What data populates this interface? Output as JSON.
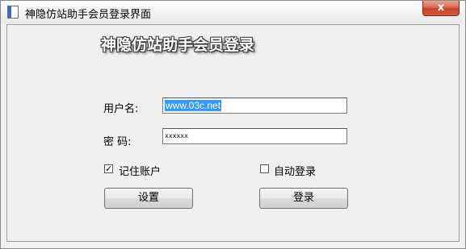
{
  "window": {
    "title": "神隐仿站助手会员登录界面",
    "close_glyph": "x",
    "icons": {
      "app": "app-icon",
      "close": "close-icon"
    }
  },
  "form": {
    "heading": "神隐仿站助手会员登录",
    "username": {
      "label": "用户名:",
      "value": "www.03c.net"
    },
    "password": {
      "label": "密 码:",
      "value": "xxxxxx"
    },
    "remember": {
      "label": "记住账户",
      "checked": true
    },
    "autologin": {
      "label": "自动登录",
      "checked": false
    },
    "settings_button": "设置",
    "login_button": "登录"
  }
}
